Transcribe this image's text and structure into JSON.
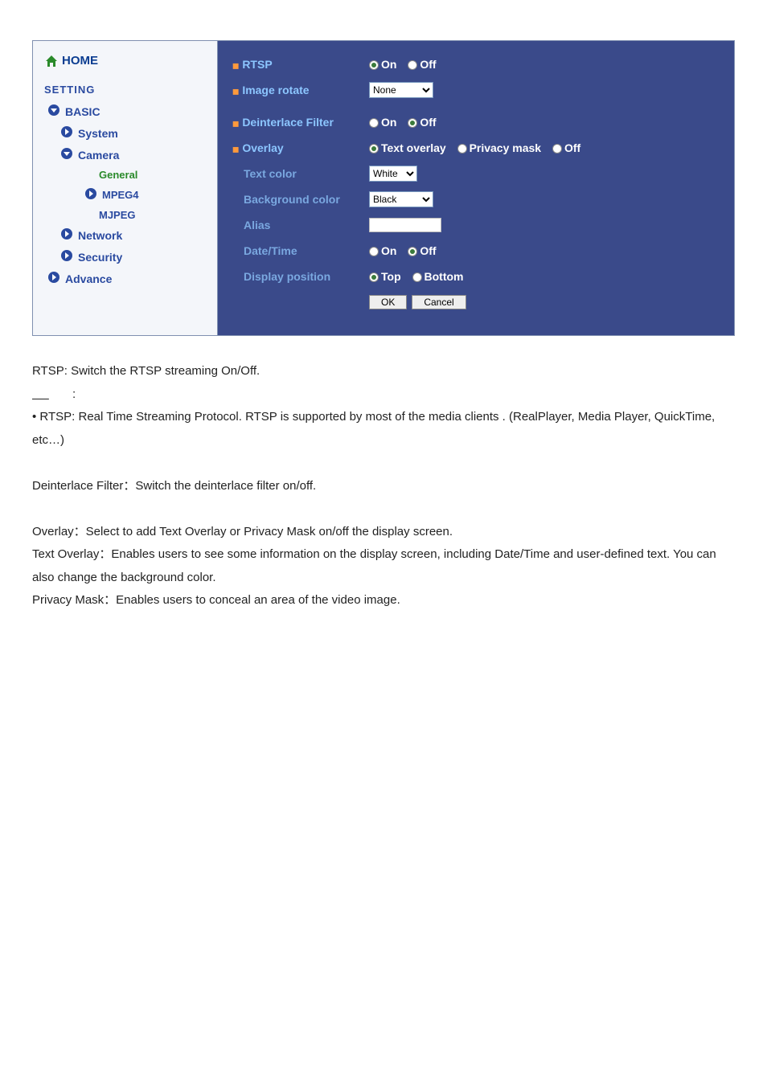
{
  "sidebar": {
    "home": "HOME",
    "setting": "SETTING",
    "items": [
      {
        "label": "BASIC",
        "icon": "down"
      },
      {
        "label": "System",
        "icon": "right"
      },
      {
        "label": "Camera",
        "icon": "down"
      },
      {
        "label": "General",
        "icon": "none",
        "selected": true
      },
      {
        "label": "MPEG4",
        "icon": "right"
      },
      {
        "label": "MJPEG",
        "icon": "none"
      },
      {
        "label": "Network",
        "icon": "right"
      },
      {
        "label": "Security",
        "icon": "right"
      },
      {
        "label": "Advance",
        "icon": "right"
      }
    ]
  },
  "content": {
    "rtsp": {
      "label": "RTSP",
      "on": "On",
      "off": "Off",
      "sel": "on"
    },
    "rotate": {
      "label": "Image rotate",
      "value": "None"
    },
    "deint": {
      "label": "Deinterlace Filter",
      "on": "On",
      "off": "Off",
      "sel": "off"
    },
    "overlay": {
      "label": "Overlay",
      "opt1": "Text overlay",
      "opt2": "Privacy mask",
      "opt3": "Off",
      "sel": "opt1"
    },
    "textcolor": {
      "label": "Text color",
      "value": "White"
    },
    "bgcolor": {
      "label": "Background color",
      "value": "Black"
    },
    "alias": {
      "label": "Alias",
      "value": ""
    },
    "datetime": {
      "label": "Date/Time",
      "on": "On",
      "off": "Off",
      "sel": "off"
    },
    "disppos": {
      "label": "Display position",
      "top": "Top",
      "bottom": "Bottom",
      "sel": "top"
    },
    "ok": "OK",
    "cancel": "Cancel"
  },
  "doc": {
    "rtsp_line": "RTSP: Switch the RTSP streaming On/Off.",
    "note_colon": ":",
    "rtsp_desc": "• RTSP: Real Time Streaming Protocol. RTSP is supported by most of the media clients . (RealPlayer, Media Player, QuickTime, etc…)",
    "deint": "Deinterlace Filter：Switch the deinterlace filter on/off.",
    "overlay": "Overlay：Select to add Text Overlay or Privacy Mask on/off the display screen.",
    "textov": "Text Overlay：Enables users to see some information on the display screen, including Date/Time and user-defined text. You can also change the background color.",
    "priv": "Privacy Mask：Enables users to conceal an area of the video image."
  }
}
